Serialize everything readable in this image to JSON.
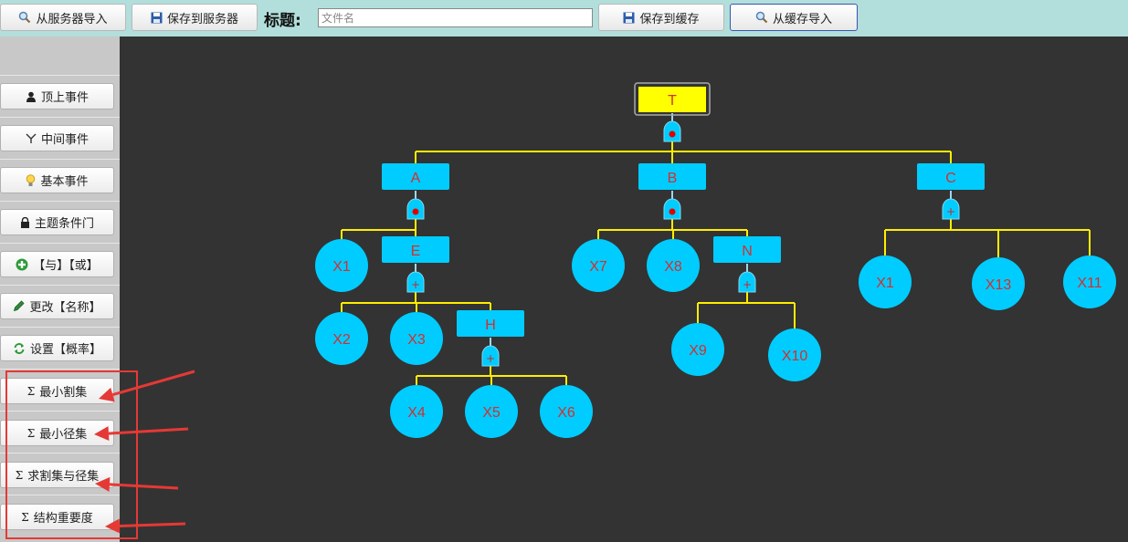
{
  "toolbar": {
    "import_server_label": "从服务器导入",
    "save_server_label": "保存到服务器",
    "title_label": "标题:",
    "title_placeholder": "文件名",
    "title_value": "",
    "save_cache_label": "保存到缓存",
    "import_cache_label": "从缓存导入"
  },
  "sidebar": {
    "items": [
      {
        "label": "顶上事件",
        "icon": "user-icon"
      },
      {
        "label": "中间事件",
        "icon": "fork-icon"
      },
      {
        "label": "基本事件",
        "icon": "lightbulb-icon"
      },
      {
        "label": "主题条件门",
        "icon": "lock-icon"
      },
      {
        "label": "【与】【或】",
        "icon": "plus-icon"
      },
      {
        "label": "更改【名称】",
        "icon": "pencil-icon"
      },
      {
        "label": "设置【概率】",
        "icon": "refresh-icon"
      },
      {
        "label": "最小割集",
        "icon": "sigma-icon"
      },
      {
        "label": "最小径集",
        "icon": "sigma-icon"
      },
      {
        "label": "求割集与径集",
        "icon": "sigma-icon"
      },
      {
        "label": "结构重要度",
        "icon": "sigma-icon"
      }
    ]
  },
  "colors": {
    "toolbar_bg": "#b2dfdb",
    "canvas_bg": "#333333",
    "node_fill": "#00ccff",
    "node_text": "#d32f2f",
    "top_event_fill": "#ffff00",
    "edge": "#ffee00",
    "annotation": "#e53935"
  },
  "tree": {
    "events": [
      {
        "id": "T",
        "label": "T",
        "kind": "top"
      },
      {
        "id": "A",
        "label": "A",
        "kind": "intermediate"
      },
      {
        "id": "B",
        "label": "B",
        "kind": "intermediate"
      },
      {
        "id": "C",
        "label": "C",
        "kind": "intermediate"
      },
      {
        "id": "E",
        "label": "E",
        "kind": "intermediate"
      },
      {
        "id": "H",
        "label": "H",
        "kind": "intermediate"
      },
      {
        "id": "N",
        "label": "N",
        "kind": "intermediate"
      }
    ],
    "basic_events": [
      {
        "id": "A_X1",
        "label": "X1"
      },
      {
        "id": "X2",
        "label": "X2"
      },
      {
        "id": "X3",
        "label": "X3"
      },
      {
        "id": "X4",
        "label": "X4"
      },
      {
        "id": "X5",
        "label": "X5"
      },
      {
        "id": "X6",
        "label": "X6"
      },
      {
        "id": "X7",
        "label": "X7"
      },
      {
        "id": "X8",
        "label": "X8"
      },
      {
        "id": "X9",
        "label": "X9"
      },
      {
        "id": "X10",
        "label": "X10"
      },
      {
        "id": "C_X1",
        "label": "X1"
      },
      {
        "id": "X13",
        "label": "X13"
      },
      {
        "id": "X11",
        "label": "X11"
      }
    ],
    "gates": [
      {
        "id": "gT",
        "type": "AND",
        "parent": "T",
        "children": [
          "A",
          "B",
          "C"
        ]
      },
      {
        "id": "gA",
        "type": "AND",
        "parent": "A",
        "children": [
          "A_X1",
          "E"
        ]
      },
      {
        "id": "gB",
        "type": "AND",
        "parent": "B",
        "children": [
          "X7",
          "X8",
          "N"
        ]
      },
      {
        "id": "gC",
        "type": "OR",
        "parent": "C",
        "children": [
          "C_X1",
          "X13",
          "X11"
        ]
      },
      {
        "id": "gE",
        "type": "OR",
        "parent": "E",
        "children": [
          "X2",
          "X3",
          "H"
        ]
      },
      {
        "id": "gH",
        "type": "OR",
        "parent": "H",
        "children": [
          "X4",
          "X5",
          "X6"
        ]
      },
      {
        "id": "gN",
        "type": "OR",
        "parent": "N",
        "children": [
          "X9",
          "X10"
        ]
      }
    ]
  }
}
